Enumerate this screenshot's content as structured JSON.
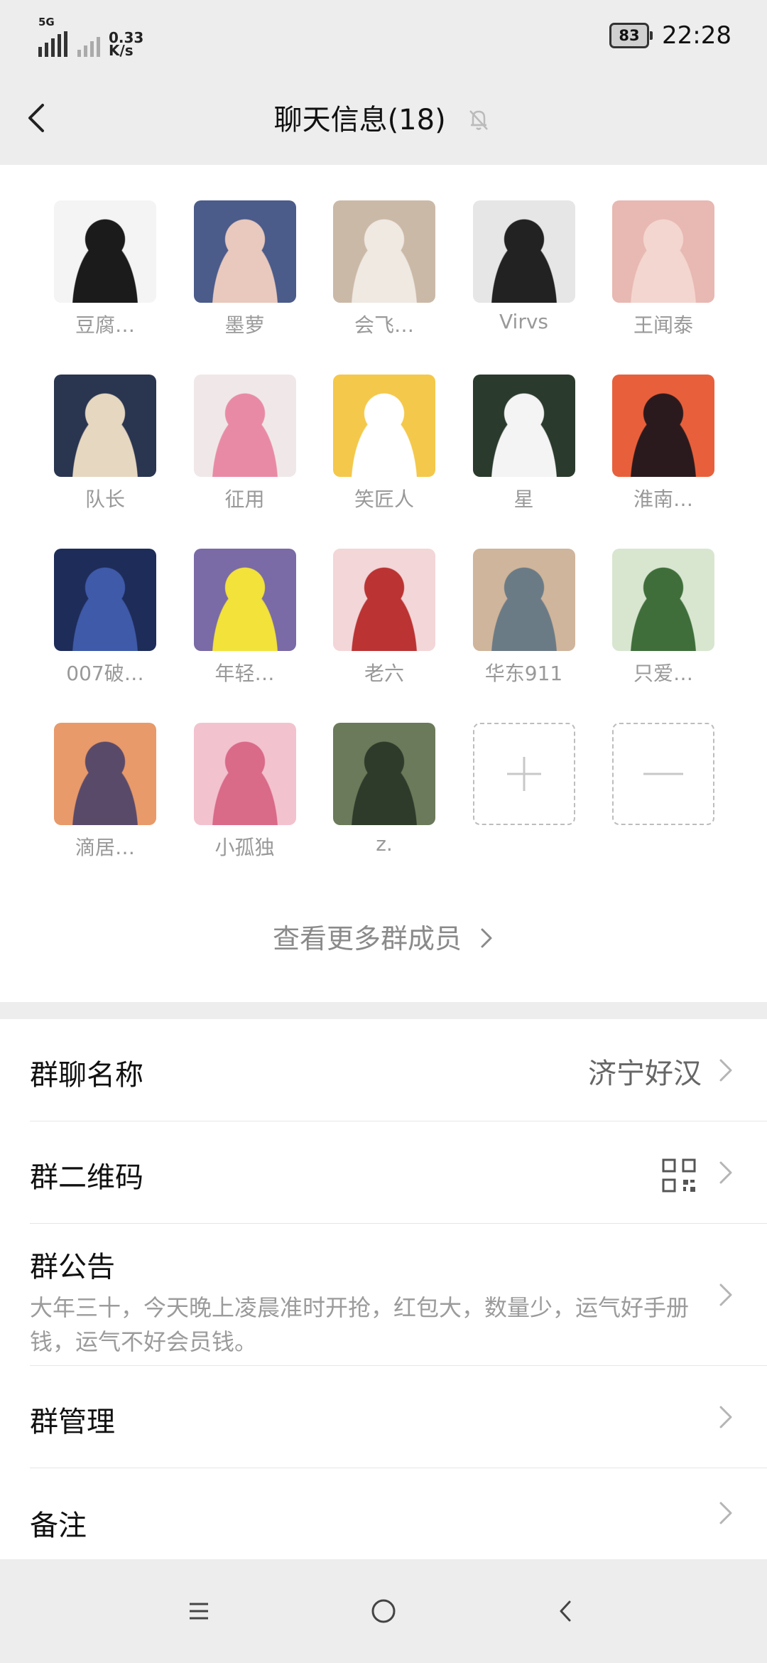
{
  "status_bar": {
    "network_type": "5G",
    "speed_value": "0.33",
    "speed_unit": "K/s",
    "battery": "83",
    "time": "22:28"
  },
  "header": {
    "title": "聊天信息(18)",
    "back_icon": "chevron-left-icon",
    "mute_icon": "bell-off-icon"
  },
  "members": [
    {
      "name": "豆腐…",
      "avatar_colors": [
        "#f4f4f4",
        "#1b1b1b"
      ]
    },
    {
      "name": "墨萝",
      "avatar_colors": [
        "#4b5b8a",
        "#e9c9bd"
      ]
    },
    {
      "name": "会飞…",
      "avatar_colors": [
        "#cbb9a8",
        "#efe9e2"
      ]
    },
    {
      "name": "Virvs",
      "avatar_colors": [
        "#e6e6e6",
        "#222222"
      ]
    },
    {
      "name": "王闻泰",
      "avatar_colors": [
        "#e8b8b2",
        "#f3d6cf"
      ]
    },
    {
      "name": "队长",
      "avatar_colors": [
        "#2a3550",
        "#e6d7c0"
      ]
    },
    {
      "name": "征用",
      "avatar_colors": [
        "#f0e8e8",
        "#e88aa6"
      ]
    },
    {
      "name": "笑匠人",
      "avatar_colors": [
        "#f4c84a",
        "#ffffff"
      ]
    },
    {
      "name": "星",
      "avatar_colors": [
        "#2a3a2c",
        "#f4f4f4"
      ]
    },
    {
      "name": "淮南…",
      "avatar_colors": [
        "#e8603b",
        "#2b1a1d"
      ]
    },
    {
      "name": "007破…",
      "avatar_colors": [
        "#1e2c5a",
        "#3e5aa8"
      ]
    },
    {
      "name": "年轻…",
      "avatar_colors": [
        "#7a6aa6",
        "#f2e23a"
      ]
    },
    {
      "name": "老六",
      "avatar_colors": [
        "#f3d6d8",
        "#b33"
      ]
    },
    {
      "name": "华东911",
      "avatar_colors": [
        "#cfb59b",
        "#6b7b86"
      ]
    },
    {
      "name": "只爱…",
      "avatar_colors": [
        "#d8e6d0",
        "#3f6e3a"
      ]
    },
    {
      "name": "滴居…",
      "avatar_colors": [
        "#e89a6a",
        "#5a4a6a"
      ]
    },
    {
      "name": "小孤独",
      "avatar_colors": [
        "#f3c2cf",
        "#d96a88"
      ]
    },
    {
      "name": "z.",
      "avatar_colors": [
        "#6b7a5a",
        "#2e3a2a"
      ]
    }
  ],
  "add_member_icon": "plus-icon",
  "remove_member_icon": "minus-icon",
  "see_more": "查看更多群成员",
  "settings": {
    "group_name_label": "群聊名称",
    "group_name_value": "济宁好汉",
    "qr_label": "群二维码",
    "qr_icon": "qr-code-icon",
    "notice_label": "群公告",
    "notice_text": "大年三十，今天晚上凌晨准时开抢，红包大，数量少，运气好手册钱，运气不好会员钱。",
    "manage_label": "群管理",
    "remark_label": "备注"
  },
  "nav_bar": {
    "menu_icon": "menu-icon",
    "home_icon": "home-circle-icon",
    "back_icon": "back-triangle-icon"
  }
}
